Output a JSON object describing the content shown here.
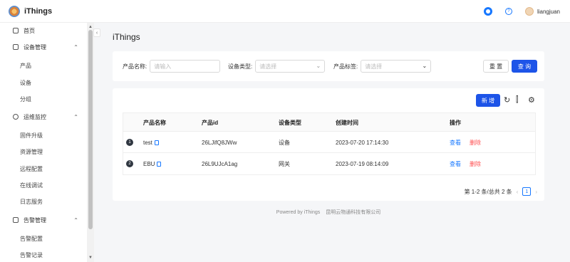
{
  "app": {
    "name": "iThings"
  },
  "header": {
    "username": "liangjuan"
  },
  "sidebar": {
    "items": [
      {
        "label": "首页"
      },
      {
        "label": "设备管理",
        "children": [
          "产品",
          "设备",
          "分组"
        ]
      },
      {
        "label": "运维监控",
        "children": [
          "固件升级",
          "资源管理",
          "远程配置",
          "在线调试",
          "日志服务"
        ]
      },
      {
        "label": "告警管理",
        "children": [
          "告警配置",
          "告警记录"
        ]
      }
    ]
  },
  "page": {
    "title": "iThings"
  },
  "search": {
    "product_name_label": "产品名称:",
    "product_name_placeholder": "请输入",
    "device_type_label": "设备类型:",
    "device_type_placeholder": "请选择",
    "product_tag_label": "产品标签:",
    "product_tag_placeholder": "请选择",
    "reset_label": "重 置",
    "query_label": "查 询"
  },
  "table": {
    "add_label": "新 增",
    "columns": [
      "产品名称",
      "产品id",
      "设备类型",
      "创建时间",
      "操作"
    ],
    "rows": [
      {
        "index": "1",
        "name": "test",
        "id": "26LJifQ8JWw",
        "type": "设备",
        "created": "2023-07-20 17:14:30",
        "view": "查看",
        "delete": "删除"
      },
      {
        "index": "2",
        "name": "EBU",
        "id": "26L9UJcA1ag",
        "type": "网关",
        "created": "2023-07-19 08:14:09",
        "view": "查看",
        "delete": "删除"
      }
    ],
    "pagination": {
      "summary": "第 1-2 条/总共 2 条",
      "current": "1"
    }
  },
  "footer": {
    "powered": "Powered by iThings",
    "company": "昆明云物通科技有限公司"
  },
  "colors": {
    "primary": "#1d54e8",
    "link": "#1677ff",
    "danger": "#ff4d4f"
  }
}
